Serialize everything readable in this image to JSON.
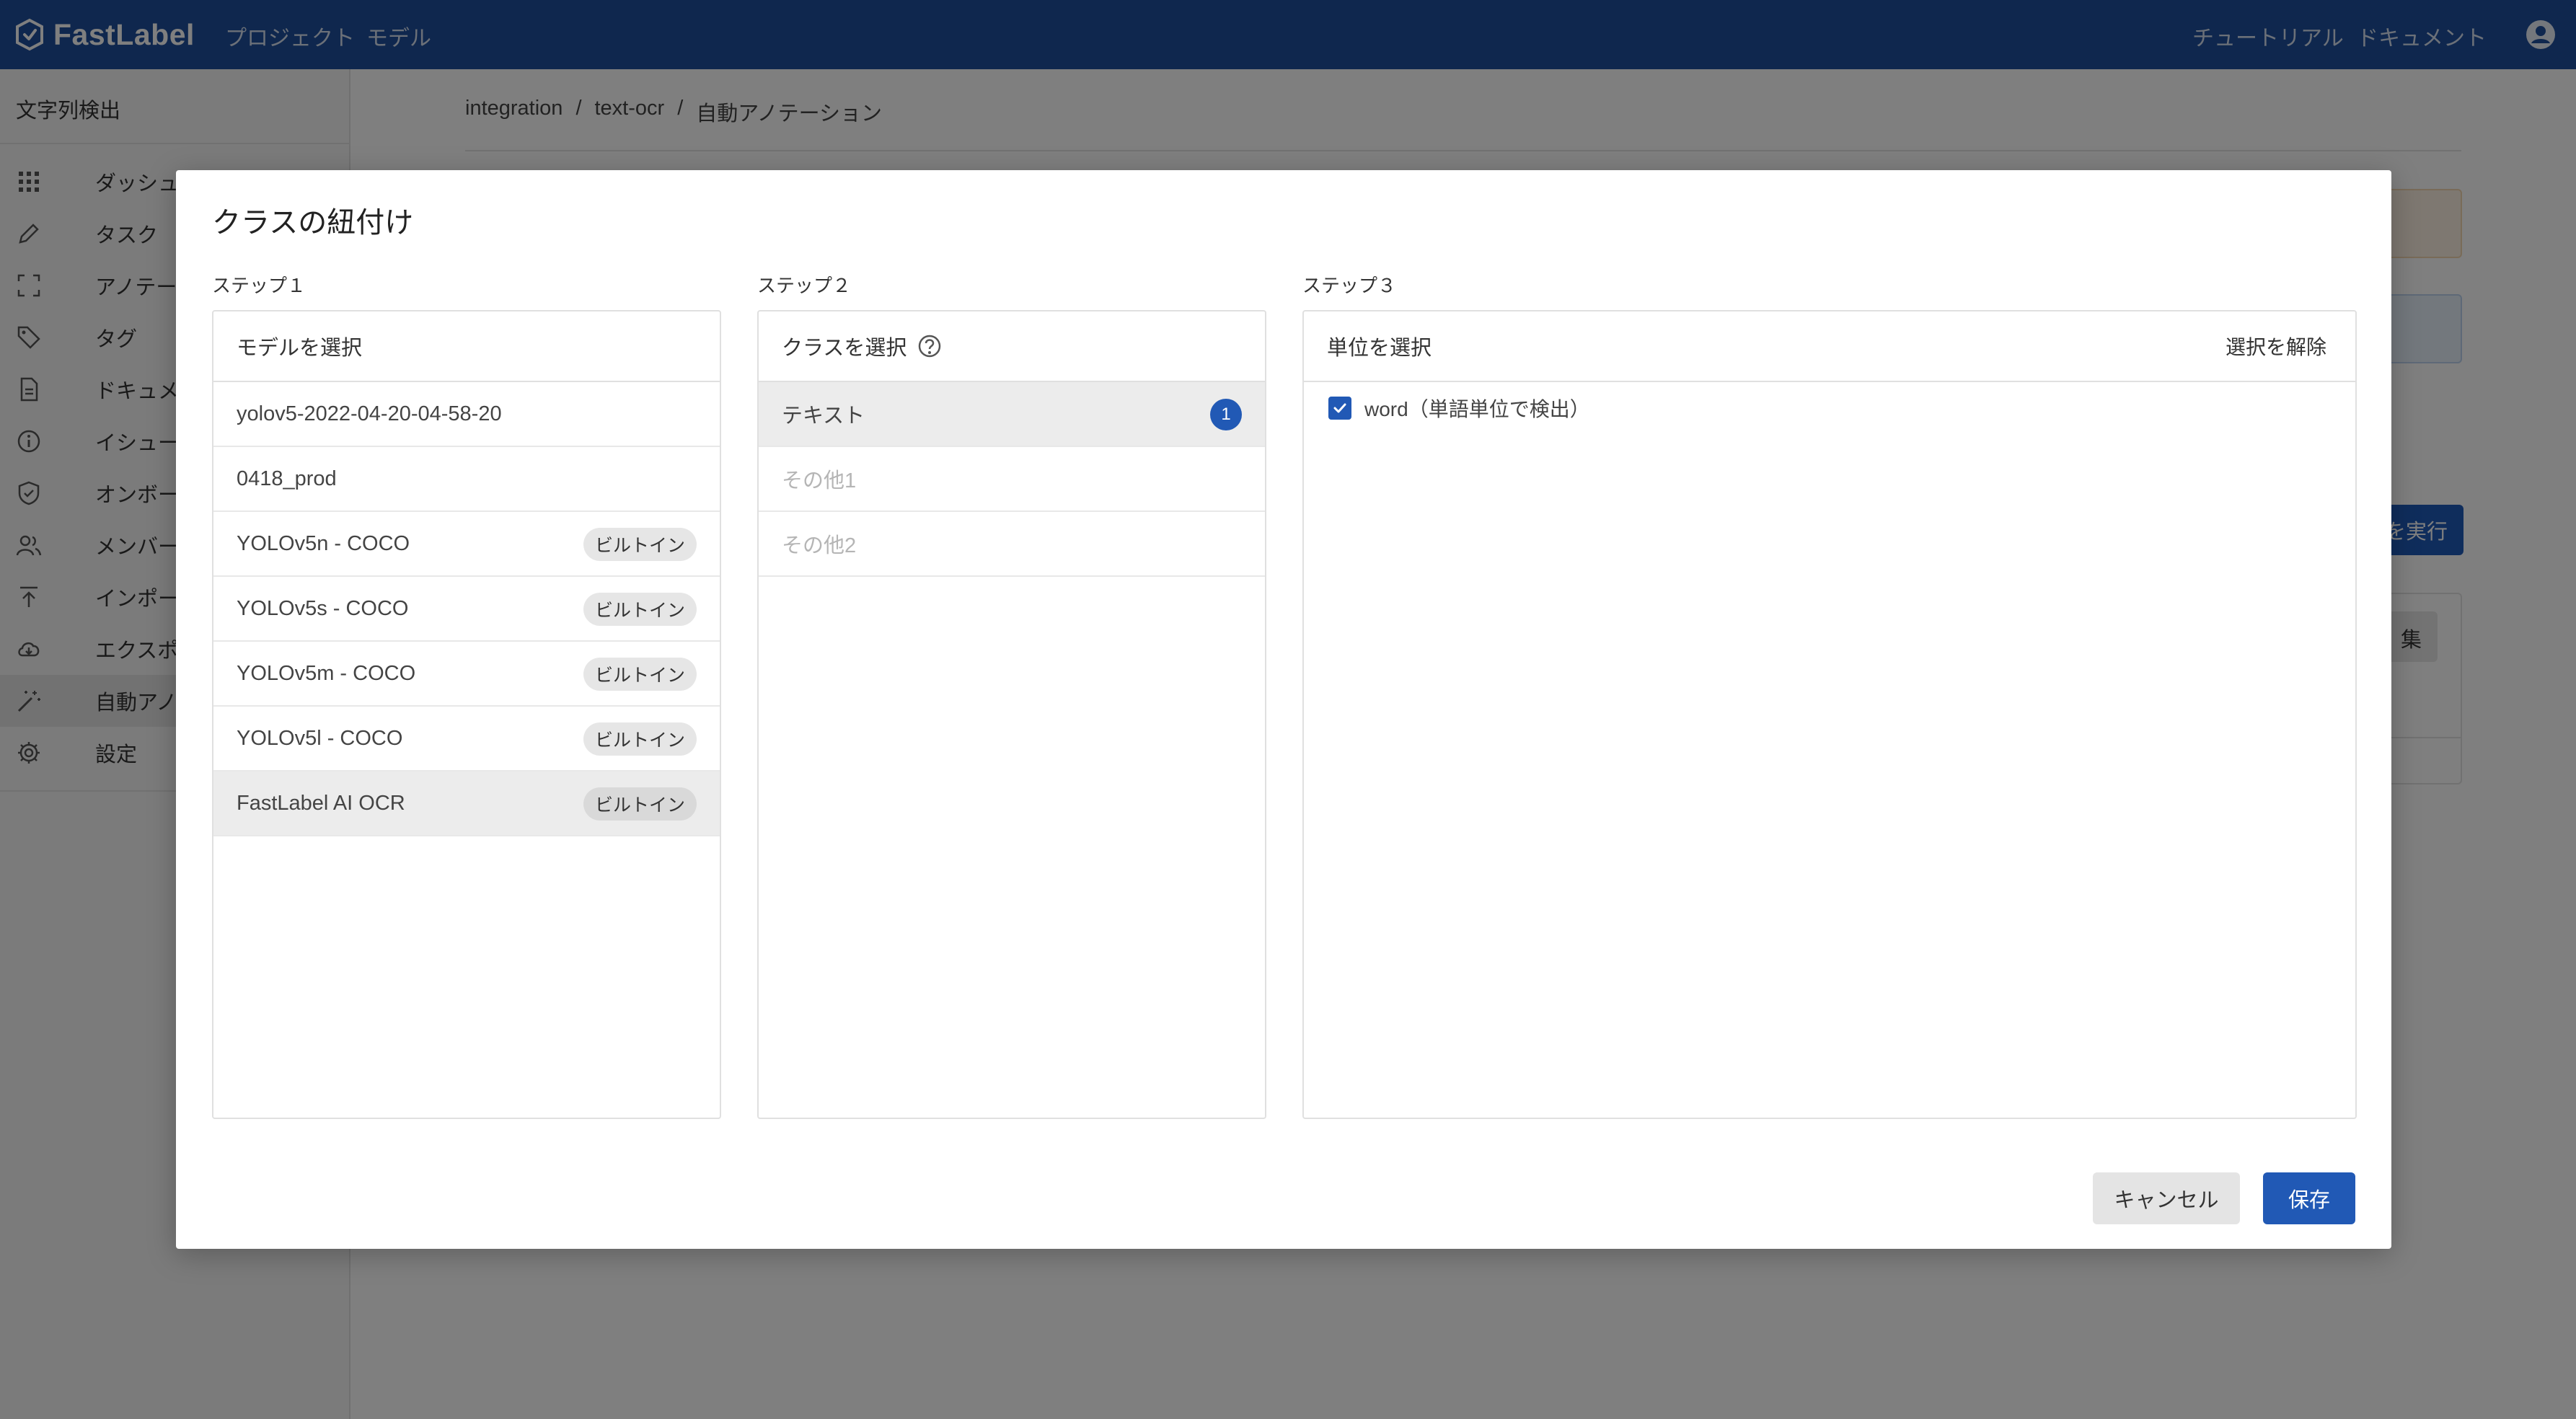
{
  "header": {
    "brand": "FastLabel",
    "nav": [
      "プロジェクト",
      "モデル"
    ],
    "right_links": [
      "チュートリアル",
      "ドキュメント"
    ],
    "colors": {
      "primary": "#1e4f9c"
    }
  },
  "sidebar": {
    "title": "文字列検出",
    "items": [
      {
        "label": "ダッシュ",
        "icon": "grid-icon"
      },
      {
        "label": "タスク",
        "icon": "pencil-icon"
      },
      {
        "label": "アノテー",
        "icon": "frame-icon"
      },
      {
        "label": "タグ",
        "icon": "tag-icon"
      },
      {
        "label": "ドキュメ",
        "icon": "document-icon"
      },
      {
        "label": "イシュー",
        "icon": "info-icon"
      },
      {
        "label": "オンボー",
        "icon": "shield-check-icon"
      },
      {
        "label": "メンバー",
        "icon": "users-icon"
      },
      {
        "label": "インポー",
        "icon": "upload-icon"
      },
      {
        "label": "エクスポ",
        "icon": "cloud-download-icon"
      },
      {
        "label": "自動アノ",
        "icon": "magic-wand-icon",
        "active": true
      },
      {
        "label": "設定",
        "icon": "gear-icon"
      }
    ]
  },
  "breadcrumb": [
    "integration",
    "text-ocr",
    "自動アノテーション"
  ],
  "background": {
    "run_button": "を実行",
    "edit_button": "集"
  },
  "modal": {
    "title": "クラスの紐付け",
    "step1": {
      "label": "ステップ１",
      "header": "モデルを選択",
      "models": [
        {
          "name": "yolov5-2022-04-20-04-58-20",
          "badge": ""
        },
        {
          "name": "0418_prod",
          "badge": ""
        },
        {
          "name": "YOLOv5n - COCO",
          "badge": "ビルトイン"
        },
        {
          "name": "YOLOv5s - COCO",
          "badge": "ビルトイン"
        },
        {
          "name": "YOLOv5m - COCO",
          "badge": "ビルトイン"
        },
        {
          "name": "YOLOv5l - COCO",
          "badge": "ビルトイン"
        },
        {
          "name": "FastLabel AI OCR",
          "badge": "ビルトイン",
          "selected": true
        }
      ]
    },
    "step2": {
      "label": "ステップ２",
      "header": "クラスを選択",
      "classes": [
        {
          "name": "テキスト",
          "count": "1",
          "selected": true
        },
        {
          "name": "その他1",
          "disabled": true
        },
        {
          "name": "その他2",
          "disabled": true
        }
      ]
    },
    "step3": {
      "label": "ステップ３",
      "header": "単位を選択",
      "deselect": "選択を解除",
      "options": [
        {
          "label": "word（単語単位で検出）",
          "checked": true
        }
      ]
    },
    "cancel": "キャンセル",
    "save": "保存"
  }
}
